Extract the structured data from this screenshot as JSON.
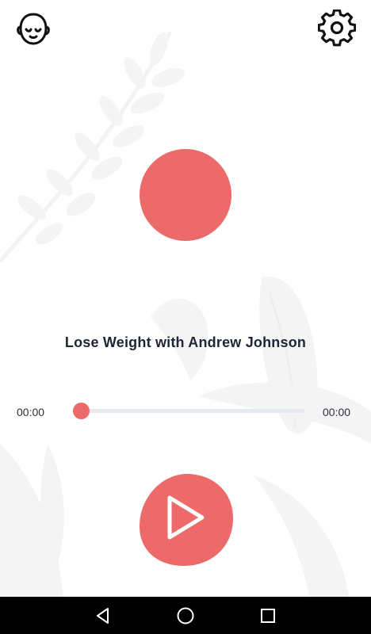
{
  "track": {
    "title": "Lose Weight with Andrew Johnson",
    "current_time": "00:00",
    "total_time": "00:00",
    "progress": 0
  },
  "header": {
    "profile_icon": "meditating-face-icon",
    "settings_icon": "gear-icon"
  },
  "player": {
    "play_icon": "play-icon"
  },
  "nav": {
    "back_icon": "back-triangle-icon",
    "home_icon": "home-circle-icon",
    "recents_icon": "recents-square-icon"
  },
  "colors": {
    "accent": "#ec6a6a",
    "track": "#e6e9ef",
    "title_text": "#1e2535",
    "nav_bar": "#000000"
  }
}
